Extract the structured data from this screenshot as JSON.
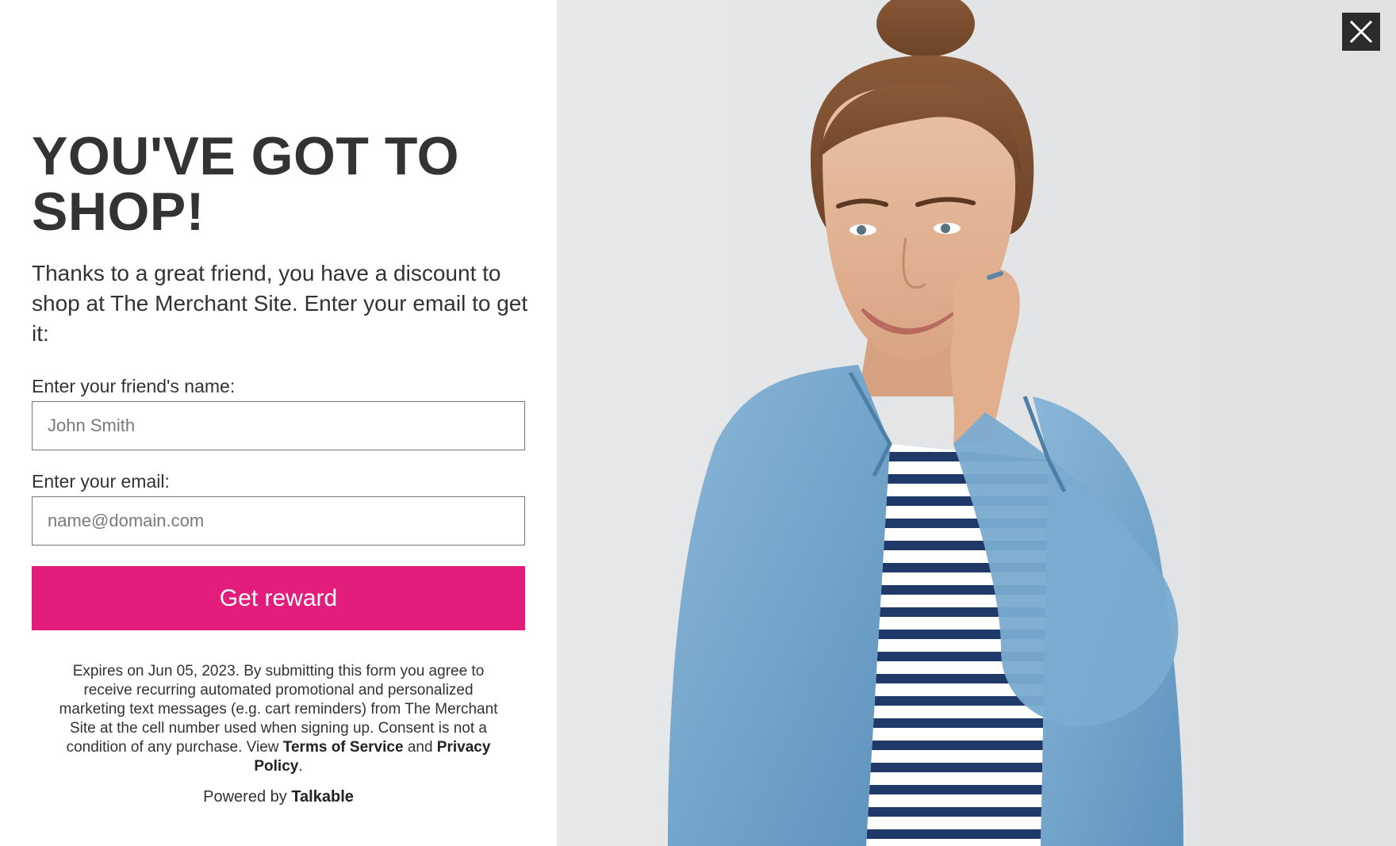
{
  "form": {
    "headline": "YOU'VE GOT TO SHOP!",
    "intro": "Thanks to a great friend, you have a discount to shop at The Merchant Site. Enter your email to get it:",
    "friend_name_label": "Enter your friend's name:",
    "friend_name_placeholder": "John Smith",
    "email_label": "Enter your email:",
    "email_placeholder": "name@domain.com",
    "submit_label": "Get reward"
  },
  "legal": {
    "text": "Expires on Jun 05, 2023. By submitting this form you agree to receive recurring automated promotional and personalized marketing text messages (e.g. cart reminders) from The Merchant Site at the cell number used when signing up. Consent is not a condition of any purchase.",
    "view_prefix": "View",
    "terms_link": "Terms of Service",
    "and_word": "and",
    "privacy_link": "Privacy Policy",
    "end_punct": "."
  },
  "footer": {
    "powered_prefix": "Powered by",
    "brand": "Talkable"
  },
  "close_icon": "close-icon",
  "colors": {
    "accent": "#e21d7b",
    "text": "#333333",
    "photo_bg": "#e4e6e7"
  }
}
